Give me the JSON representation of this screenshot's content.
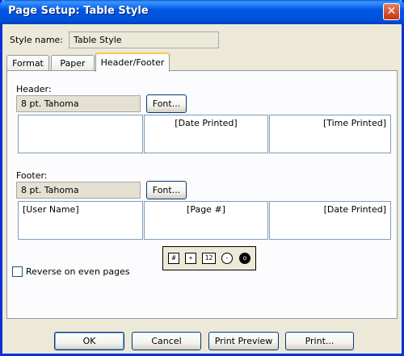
{
  "window": {
    "title": "Page Setup: Table Style",
    "close_glyph": "✕"
  },
  "style_name": {
    "label": "Style name:",
    "value": "Table Style"
  },
  "tabs": [
    {
      "label": "Format",
      "active": false
    },
    {
      "label": "Paper",
      "active": false
    },
    {
      "label": "Header/Footer",
      "active": true
    }
  ],
  "header": {
    "label": "Header:",
    "font_value": "8 pt. Tahoma",
    "font_button": "Font...",
    "left": "",
    "center": "[Date Printed]",
    "right": "[Time Printed]"
  },
  "footer": {
    "label": "Footer:",
    "font_value": "8 pt. Tahoma",
    "font_button": "Font...",
    "left": "[User Name]",
    "center": "[Page #]",
    "right": "[Date Printed]"
  },
  "toolbar_icons": [
    "page-number-icon",
    "total-pages-icon",
    "date-icon",
    "time-icon",
    "user-name-icon"
  ],
  "reverse_checkbox": {
    "label": "Reverse on even pages",
    "checked": false
  },
  "buttons": {
    "ok": "OK",
    "cancel": "Cancel",
    "print_preview": "Print Preview",
    "print": "Print..."
  }
}
